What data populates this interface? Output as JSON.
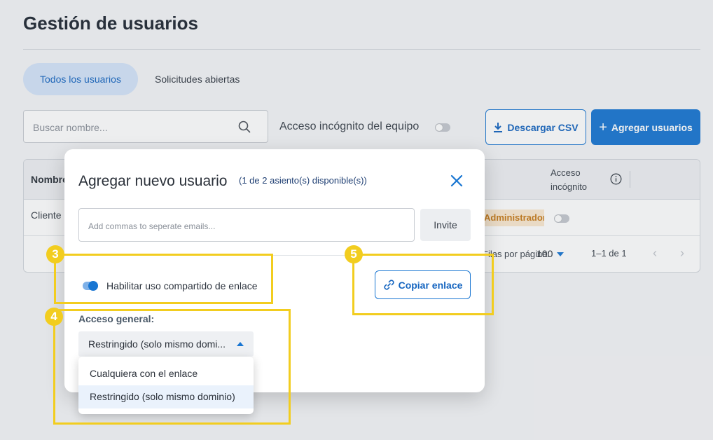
{
  "page": {
    "title": "Gestión de usuarios",
    "tabs": [
      {
        "label": "Todos los usuarios",
        "active": true
      },
      {
        "label": "Solicitudes abiertas",
        "active": false
      }
    ],
    "search": {
      "placeholder": "Buscar nombre..."
    },
    "incognito_label": "Acceso incógnito del equipo",
    "download_csv_label": "Descargar CSV",
    "add_users_label": "Agregar usuarios"
  },
  "table": {
    "col_name": "Nombre",
    "col_incognito": [
      "Acceso",
      "incógnito"
    ],
    "row1": {
      "name": "Cliente",
      "role": "Administrador principal"
    },
    "pagination": {
      "per_page_label": "Filas por página:",
      "per_page_value": "100",
      "range": "1–1 de 1"
    }
  },
  "modal": {
    "title": "Agregar nuevo usuario",
    "seats": "(1 de 2 asiento(s) disponible(s))",
    "email_placeholder": "Add commas to seperate emails...",
    "invite_label": "Invite",
    "link_sharing_label": "Habilitar uso compartido de enlace",
    "link_sharing_enabled": true,
    "copy_link_label": "Copiar enlace",
    "general_access_label": "Acceso general:",
    "general_access_value": "Restringido (solo mismo domi...",
    "options": [
      "Cualquiera con el enlace",
      "Restringido (solo mismo dominio)"
    ]
  },
  "callouts": [
    "3",
    "4",
    "5"
  ],
  "colors": {
    "accent": "#1976d2",
    "callout": "#f2cd1f",
    "role_badge_bg": "#fbe9d0"
  }
}
